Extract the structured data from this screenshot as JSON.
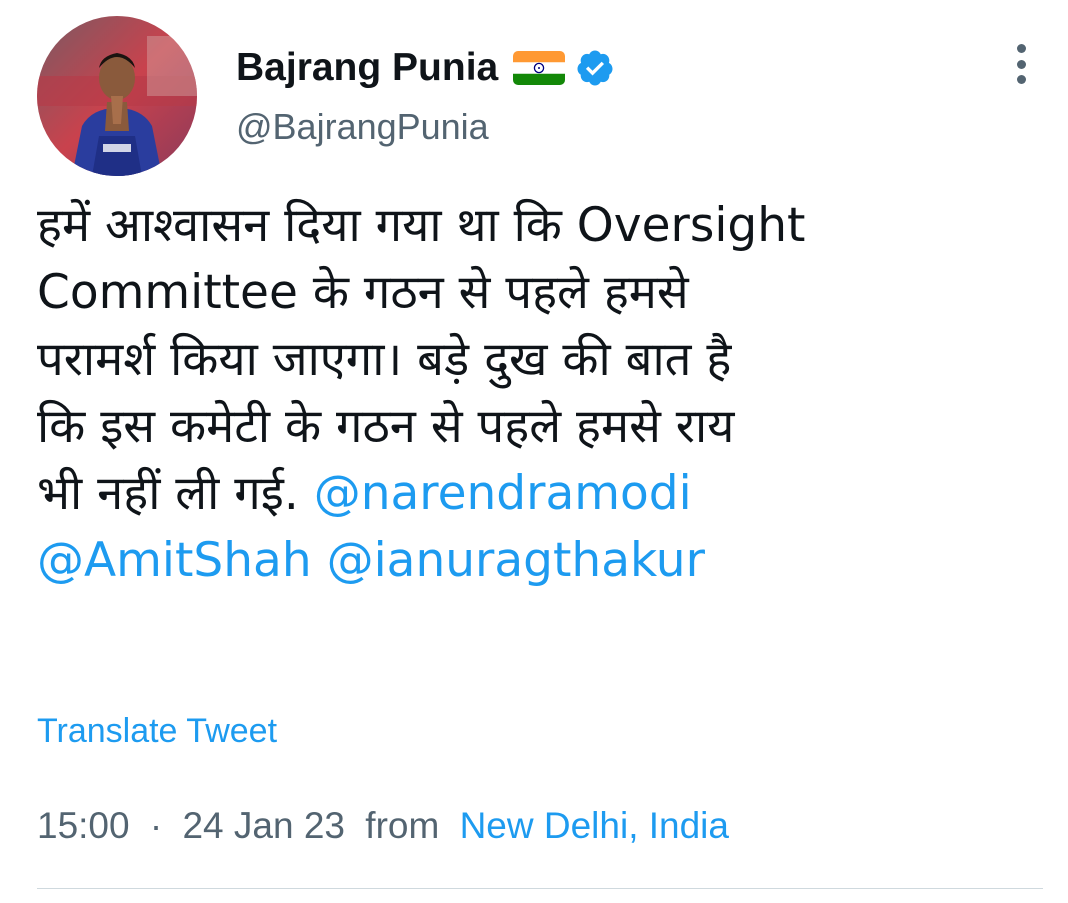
{
  "author": {
    "display_name": "Bajrang Punia",
    "handle": "@BajrangPunia",
    "flag_icon": "india-flag-icon",
    "verified_icon": "verified-badge-icon"
  },
  "tweet": {
    "lines": [
      [
        {
          "text": "हमें आश्वासन दिया गया था कि Oversight",
          "mention": false
        }
      ],
      [
        {
          "text": "Committee के गठन से पहले हमसे",
          "mention": false
        }
      ],
      [
        {
          "text": "परामर्श किया जाएगा। बड़े दुख की बात है",
          "mention": false
        }
      ],
      [
        {
          "text": "कि इस कमेटी के गठन से पहले हमसे राय",
          "mention": false
        }
      ],
      [
        {
          "text": "भी नहीं ली गई. ",
          "mention": false
        },
        {
          "text": "@narendramodi",
          "mention": true
        }
      ],
      [
        {
          "text": "@AmitShah",
          "mention": true
        },
        {
          "text": " ",
          "mention": false
        },
        {
          "text": "@ianuragthakur",
          "mention": true
        }
      ]
    ],
    "translate_label": "Translate Tweet",
    "time": "15:00",
    "separator": "·",
    "date": "24 Jan 23",
    "from_label": "from",
    "location": "New Delhi, India"
  },
  "colors": {
    "link": "#1d9bf0",
    "secondary_text": "#536471",
    "primary_text": "#0f1419",
    "divider": "#cfd9de"
  }
}
